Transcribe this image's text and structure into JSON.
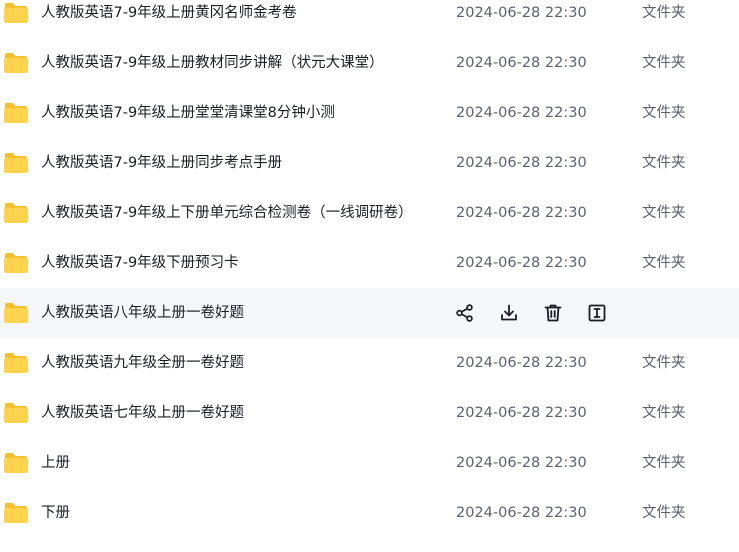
{
  "files": [
    {
      "name": "人教版英语7-9年级上册黄冈名师金考卷",
      "time": "2024-06-28 22:30",
      "type": "文件夹"
    },
    {
      "name": "人教版英语7-9年级上册教材同步讲解（状元大课堂）",
      "time": "2024-06-28 22:30",
      "type": "文件夹"
    },
    {
      "name": "人教版英语7-9年级上册堂堂清课堂8分钟小测",
      "time": "2024-06-28 22:30",
      "type": "文件夹"
    },
    {
      "name": "人教版英语7-9年级上册同步考点手册",
      "time": "2024-06-28 22:30",
      "type": "文件夹"
    },
    {
      "name": "人教版英语7-9年级上下册单元综合检测卷（一线调研卷）",
      "time": "2024-06-28 22:30",
      "type": "文件夹"
    },
    {
      "name": "人教版英语7-9年级下册预习卡",
      "time": "2024-06-28 22:30",
      "type": "文件夹"
    },
    {
      "name": "人教版英语八年级上册一卷好题",
      "hovered": true
    },
    {
      "name": "人教版英语九年级全册一卷好题",
      "time": "2024-06-28 22:30",
      "type": "文件夹"
    },
    {
      "name": "人教版英语七年级上册一卷好题",
      "time": "2024-06-28 22:30",
      "type": "文件夹"
    },
    {
      "name": "上册",
      "time": "2024-06-28 22:30",
      "type": "文件夹"
    },
    {
      "name": "下册",
      "time": "2024-06-28 22:30",
      "type": "文件夹"
    }
  ],
  "row_actions": [
    "share-icon",
    "download-icon",
    "delete-icon",
    "rename-icon"
  ],
  "colors": {
    "folder_back": "#f5c032",
    "folder_front": "#ffd34d",
    "hover_bg": "#f5f6fa",
    "icon": "#1a1d24"
  }
}
